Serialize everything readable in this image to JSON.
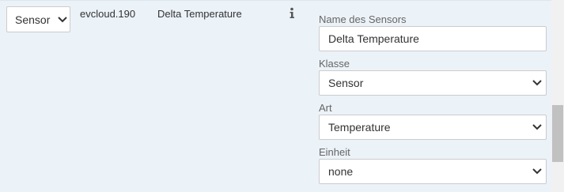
{
  "row": {
    "type_select": "Sensor",
    "device_id": "evcloud.190",
    "sensor_name": "Delta Temperature"
  },
  "form": {
    "name_label": "Name des Sensors",
    "name_value": "Delta Temperature",
    "class_label": "Klasse",
    "class_value": "Sensor",
    "kind_label": "Art",
    "kind_value": "Temperature",
    "unit_label": "Einheit",
    "unit_value": "none"
  },
  "icons": [
    "info-icon",
    "chevron-down-icon"
  ]
}
